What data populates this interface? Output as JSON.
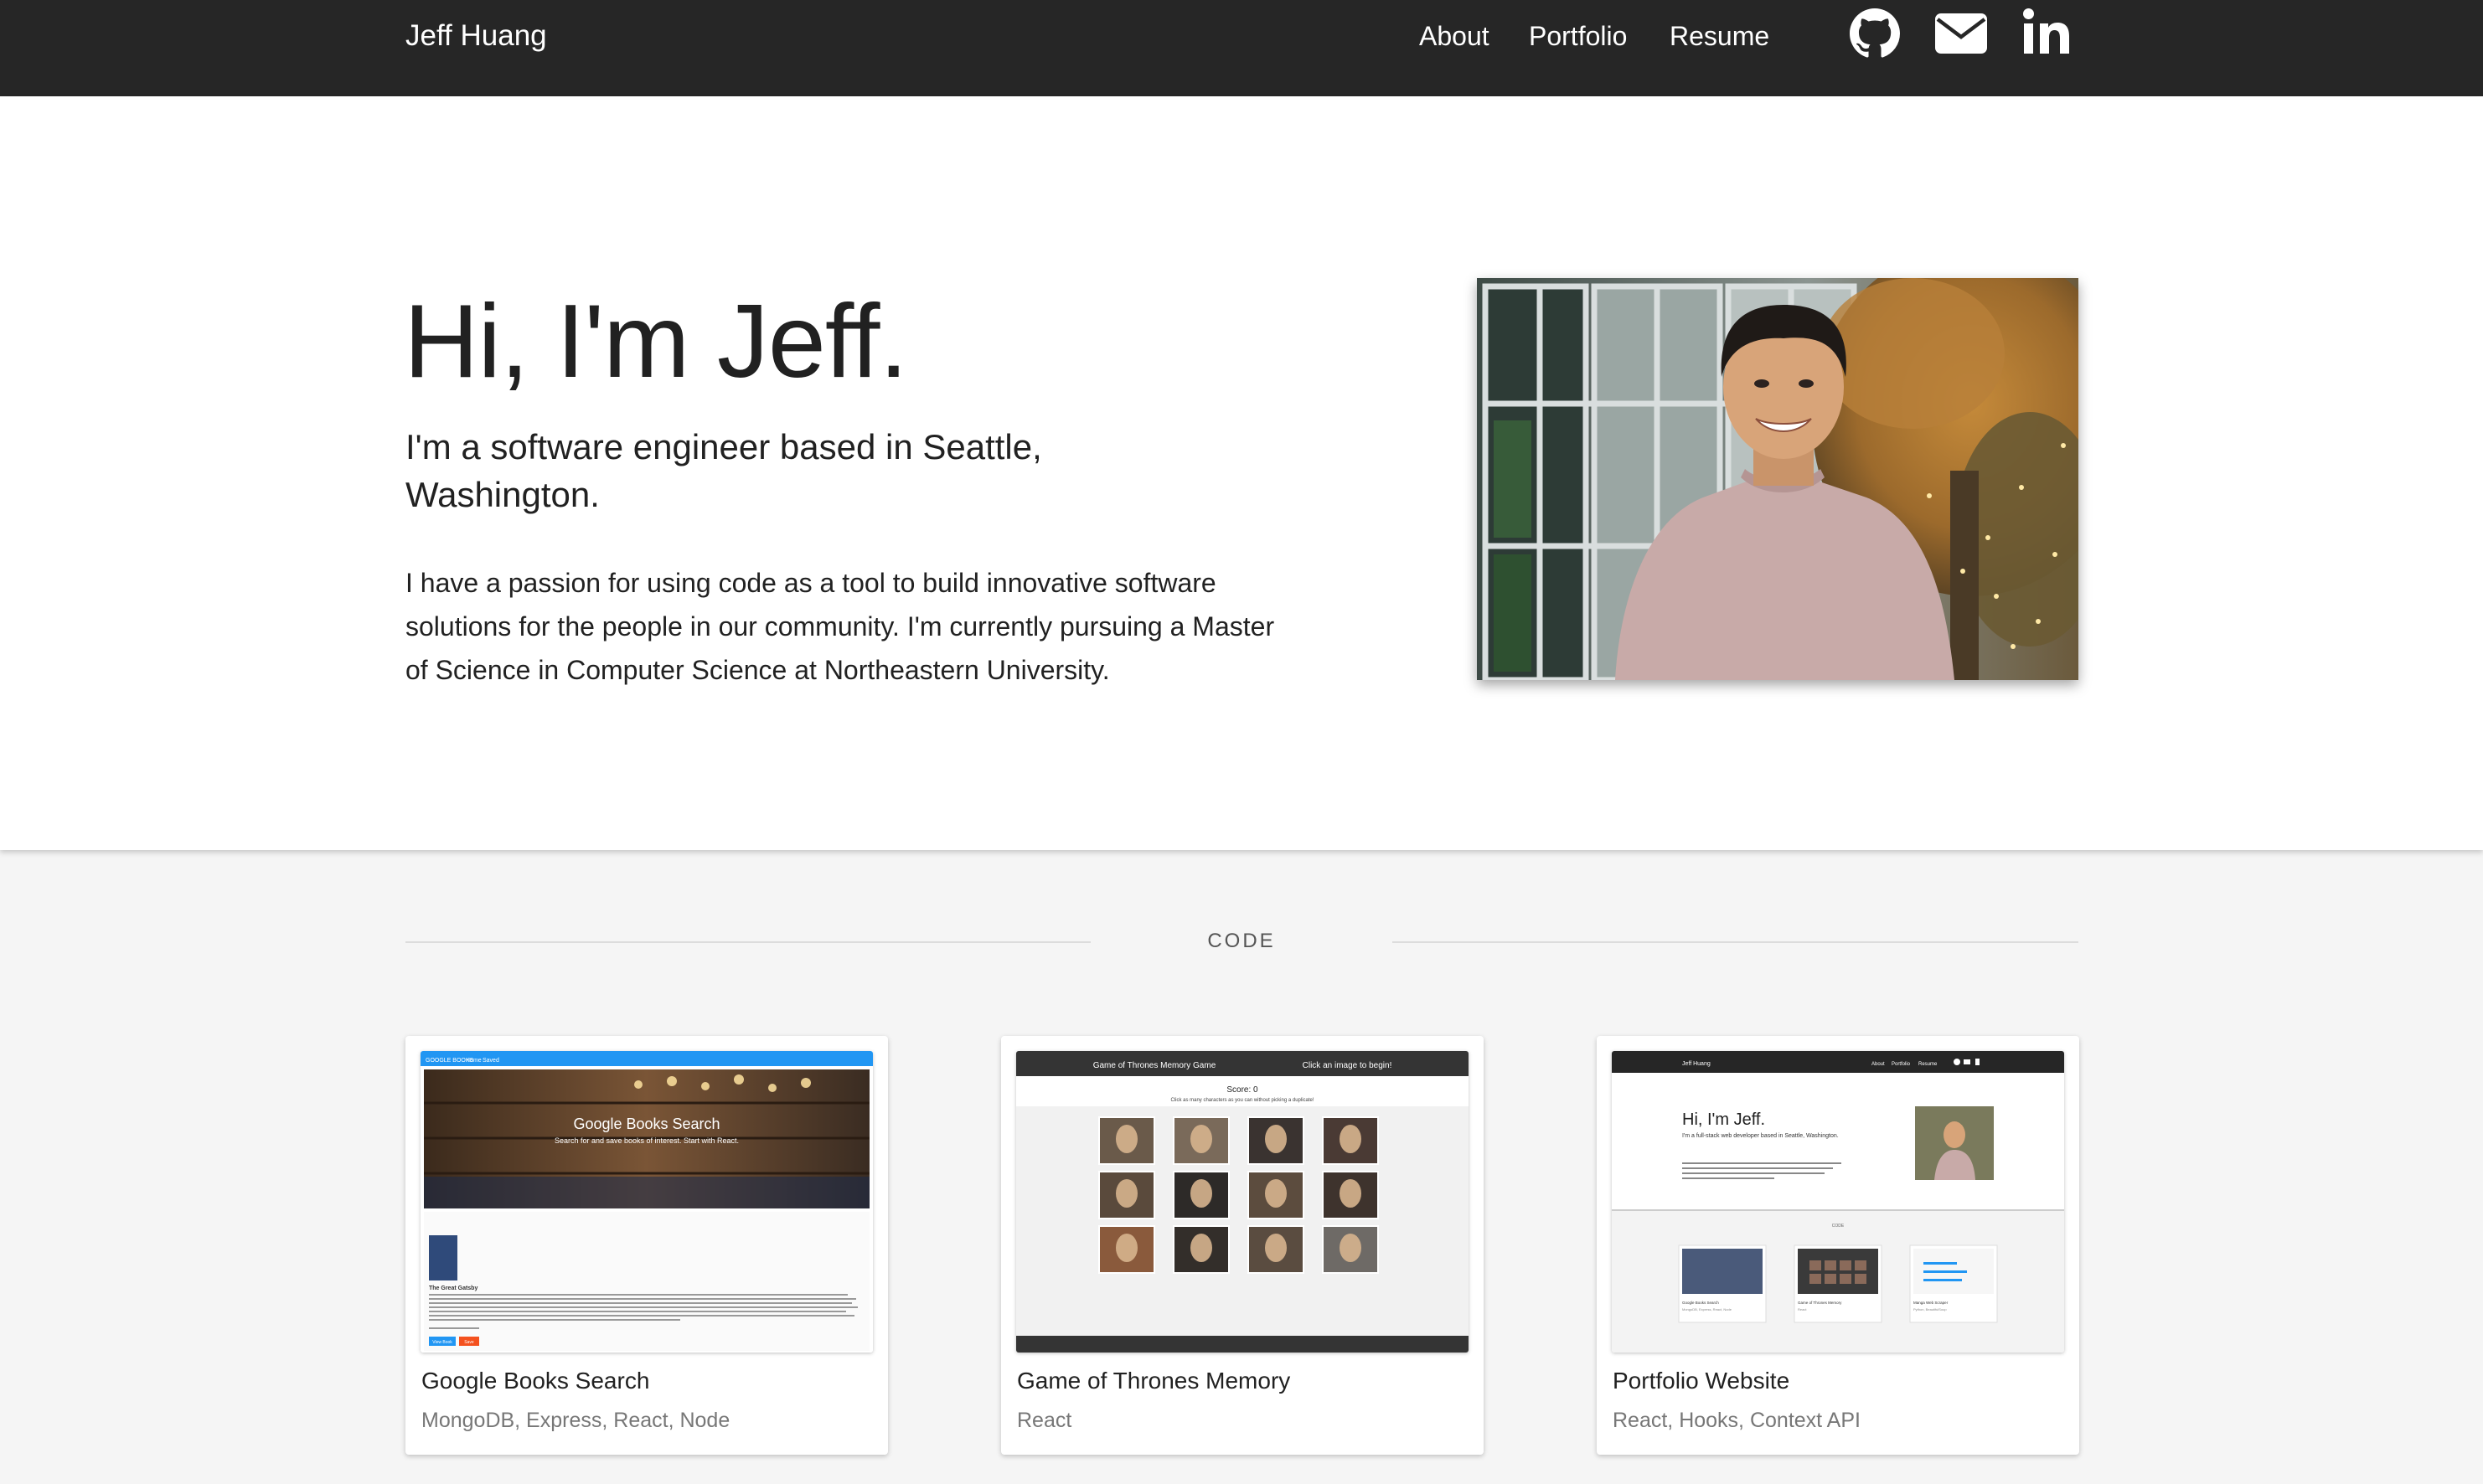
{
  "navbar": {
    "brand": "Jeff Huang",
    "links": [
      "About",
      "Portfolio",
      "Resume"
    ],
    "icons": [
      "github-icon",
      "envelope-icon",
      "linkedin-icon"
    ],
    "background": "#262626"
  },
  "hero": {
    "title": "Hi, I'm Jeff.",
    "subtitle": "I'm a software engineer based in Seattle, Washington.",
    "bio": "I have a passion for using code as a tool to build innovative software solutions for the people in our community. I'm currently pursuing a Master of Science in Computer Science at Northeastern University."
  },
  "section": {
    "label": "CODE"
  },
  "projects": [
    {
      "title": "Google Books Search",
      "tech": "MongoDB, Express, React, Node",
      "shot": {
        "nav_brand": "GOOGLE BOOKS",
        "nav_links": [
          "Home",
          "Saved"
        ],
        "banner_title": "Google Books Search",
        "banner_sub": "Search for and save books of interest. Start with React.",
        "book_title": "The Great Gatsby",
        "button_view": "View Book",
        "button_save": "Save"
      }
    },
    {
      "title": "Game of Thrones Memory",
      "tech": "React",
      "shot": {
        "header_left": "Game of Thrones Memory Game",
        "header_right": "Click an image to begin!",
        "score": "Score: 0",
        "instructions": "Click as many characters as you can without picking a duplicate!"
      }
    },
    {
      "title": "Portfolio Website",
      "tech": "React, Hooks, Context API",
      "shot": {
        "nav_brand": "Jeff Huang",
        "nav_links": [
          "About",
          "Portfolio",
          "Resume"
        ],
        "hero_title": "Hi, I'm Jeff.",
        "hero_sub": "I'm a full-stack web developer based in Seattle, Washington.",
        "section": "CODE",
        "cards": [
          "Google Books Search",
          "Game of Thrones Memory",
          "Manga Web Scraper"
        ],
        "card_techs": [
          "MongoDB, Express, React, Node",
          "React",
          "Python, BeautifulSoup"
        ]
      }
    }
  ]
}
